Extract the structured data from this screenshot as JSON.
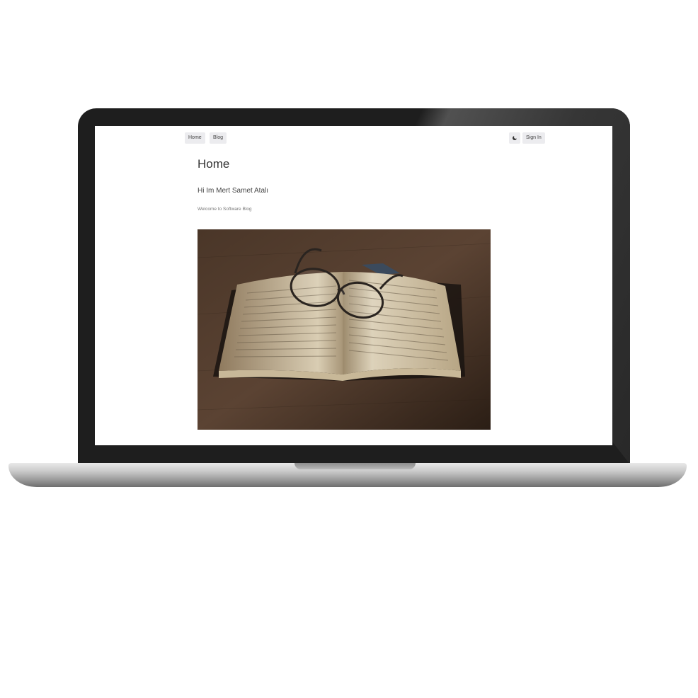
{
  "nav": {
    "home_label": "Home",
    "blog_label": "Blog",
    "theme_toggle_icon": "moon-icon",
    "signin_label": "Sign In"
  },
  "main": {
    "title": "Home",
    "greeting": "Hi Im Mert Samet Atalı",
    "welcome": "Welcome to Software Blog",
    "hero_image": "open-book-with-glasses"
  },
  "colors": {
    "device_frame": "#1e1e1e",
    "button_bg": "#ececef",
    "hero_wood": "#3d2c20"
  }
}
